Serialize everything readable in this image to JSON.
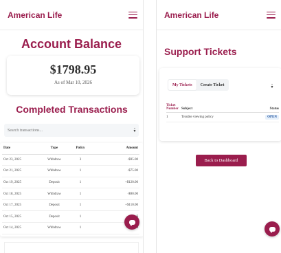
{
  "left_panel": {
    "brand": "American Life",
    "page_title": "Account Balance",
    "balance": {
      "amount": "$1798.95",
      "as_of": "As of Mar 10, 2026"
    },
    "transactions_title": "Completed Transactions",
    "search": {
      "placeholder": "Search transactions...",
      "value": ""
    },
    "table": {
      "headers": [
        "Date",
        "Type",
        "Policy",
        "Amount"
      ],
      "rows": [
        {
          "date": "Oct 23, 2025",
          "type": "Withdraw",
          "policy": "3",
          "amount": "-$95.00"
        },
        {
          "date": "Oct 21, 2025",
          "type": "Withdraw",
          "policy": "1",
          "amount": "-$75.00"
        },
        {
          "date": "Oct 19, 2025",
          "type": "Deposit",
          "policy": "1",
          "amount": "+$120.00"
        },
        {
          "date": "Oct 18, 2025",
          "type": "Withdraw",
          "policy": "1",
          "amount": "-$90.00"
        },
        {
          "date": "Oct 17, 2025",
          "type": "Deposit",
          "policy": "1",
          "amount": "+$110.00"
        },
        {
          "date": "Oct 15, 2025",
          "type": "Deposit",
          "policy": "1",
          "amount": "+$"
        },
        {
          "date": "Oct 14, 2025",
          "type": "Withdraw",
          "policy": "1",
          "amount": "-$25.00"
        }
      ]
    }
  },
  "right_panel": {
    "brand": "American Life",
    "page_title": "Support Tickets",
    "tabs": [
      {
        "label": "My Tickets",
        "active": true
      },
      {
        "label": "Create Ticket",
        "active": false
      }
    ],
    "table": {
      "headers": [
        "Ticket Number",
        "Subject",
        "Status"
      ],
      "rows": [
        {
          "number": "1",
          "subject": "Trouble viewing policy",
          "status": "OPEN"
        }
      ]
    },
    "back_button": "Back to Dashboard"
  },
  "colors": {
    "brand": "#9a1d4d",
    "negative": "#d9534f",
    "positive": "#2e9d5a",
    "open_status": "#1a4f9c"
  },
  "icons": {
    "menu": "hamburger-icon",
    "sort": "sort-icon",
    "chat": "chat-icon"
  }
}
